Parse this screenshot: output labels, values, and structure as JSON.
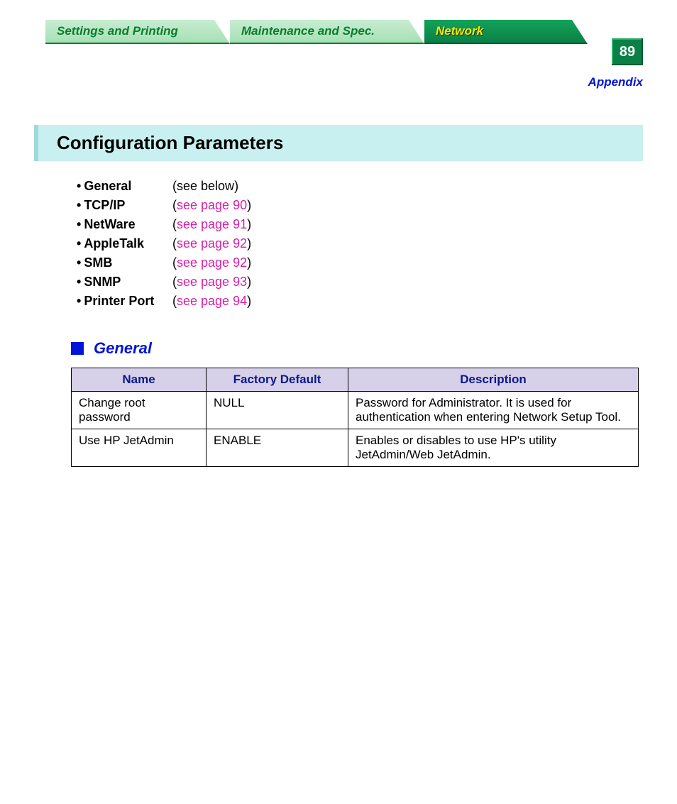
{
  "tabs": {
    "settings": "Settings and Printing",
    "maintenance": "Maintenance and Spec.",
    "network": "Network"
  },
  "page_number": "89",
  "appendix_label": "Appendix",
  "heading": "Configuration Parameters",
  "param_list": [
    {
      "label": "General",
      "ref_prefix": "(",
      "ref_link": "see below",
      "ref_link_is_link": false,
      "ref_suffix": ")"
    },
    {
      "label": "TCP/IP",
      "ref_prefix": "(",
      "ref_link": "see page 90",
      "ref_link_is_link": true,
      "ref_suffix": ")"
    },
    {
      "label": "NetWare",
      "ref_prefix": "(",
      "ref_link": "see page 91",
      "ref_link_is_link": true,
      "ref_suffix": ")"
    },
    {
      "label": "AppleTalk",
      "ref_prefix": "(",
      "ref_link": "see page 92",
      "ref_link_is_link": true,
      "ref_suffix": ")"
    },
    {
      "label": "SMB",
      "ref_prefix": "(",
      "ref_link": "see page 92",
      "ref_link_is_link": true,
      "ref_suffix": ")"
    },
    {
      "label": "SNMP",
      "ref_prefix": "(",
      "ref_link": "see page 93",
      "ref_link_is_link": true,
      "ref_suffix": ")"
    },
    {
      "label": "Printer Port",
      "ref_prefix": "(",
      "ref_link": "see page 94",
      "ref_link_is_link": true,
      "ref_suffix": ")"
    }
  ],
  "section_title": "General",
  "table": {
    "headers": {
      "name": "Name",
      "default": "Factory Default",
      "desc": "Description"
    },
    "rows": [
      {
        "name": "Change root password",
        "default": "NULL",
        "desc": "Password for Administrator. It is used for authentication when entering Network Setup Tool."
      },
      {
        "name": "Use HP JetAdmin",
        "default": "ENABLE",
        "desc": "Enables or disables to use HP's utility JetAdmin/Web JetAdmin."
      }
    ]
  }
}
